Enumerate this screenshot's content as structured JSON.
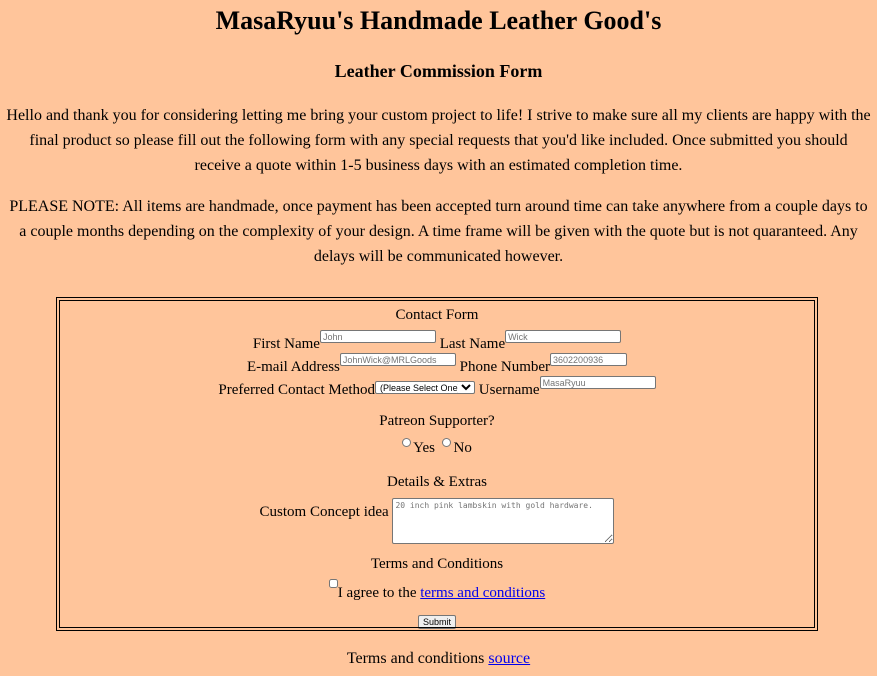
{
  "header": {
    "title": "MasaRyuu's Handmade Leather Good's",
    "subtitle": "Leather Commission Form"
  },
  "intro": {
    "text": "Hello and thank you for considering letting me bring your custom project to life! I strive to make sure all my clients are happy with the final product so please fill out the following form with any special requests that you'd like included. Once submitted you should receive a quote within 1-5 business days with an estimated completion time.",
    "note": "PLEASE NOTE: All items are handmade, once payment has been accepted turn around time can take anywhere from a couple days to a couple months depending on the complexity of your design. A time frame will be given with the quote but is not quaranteed. Any delays will be communicated however."
  },
  "form": {
    "contact_heading": "Contact Form",
    "first_name_label": "First Name",
    "first_name_placeholder": "John",
    "last_name_label": "Last Name",
    "last_name_placeholder": "Wick",
    "email_label": "E-mail Address",
    "email_placeholder": "JohnWick@MRLGoods",
    "phone_label": "Phone Number",
    "phone_placeholder": "3602200936",
    "contact_method_label": "Preferred Contact Method",
    "contact_method_selected": "(Please Select One)",
    "username_label": "Username",
    "username_placeholder": "MasaRyuu",
    "patreon_question": "Patreon Supporter?",
    "yes_label": "Yes",
    "no_label": "No",
    "details_heading": "Details & Extras",
    "concept_label": "Custom Concept idea",
    "concept_placeholder": "20 inch pink lambskin with gold hardware.",
    "terms_heading": "Terms and Conditions",
    "agree_text": "I agree to the",
    "terms_link": "terms and conditions",
    "submit_label": "Submit"
  },
  "footer": {
    "text": "Terms and conditions",
    "link": "source"
  }
}
